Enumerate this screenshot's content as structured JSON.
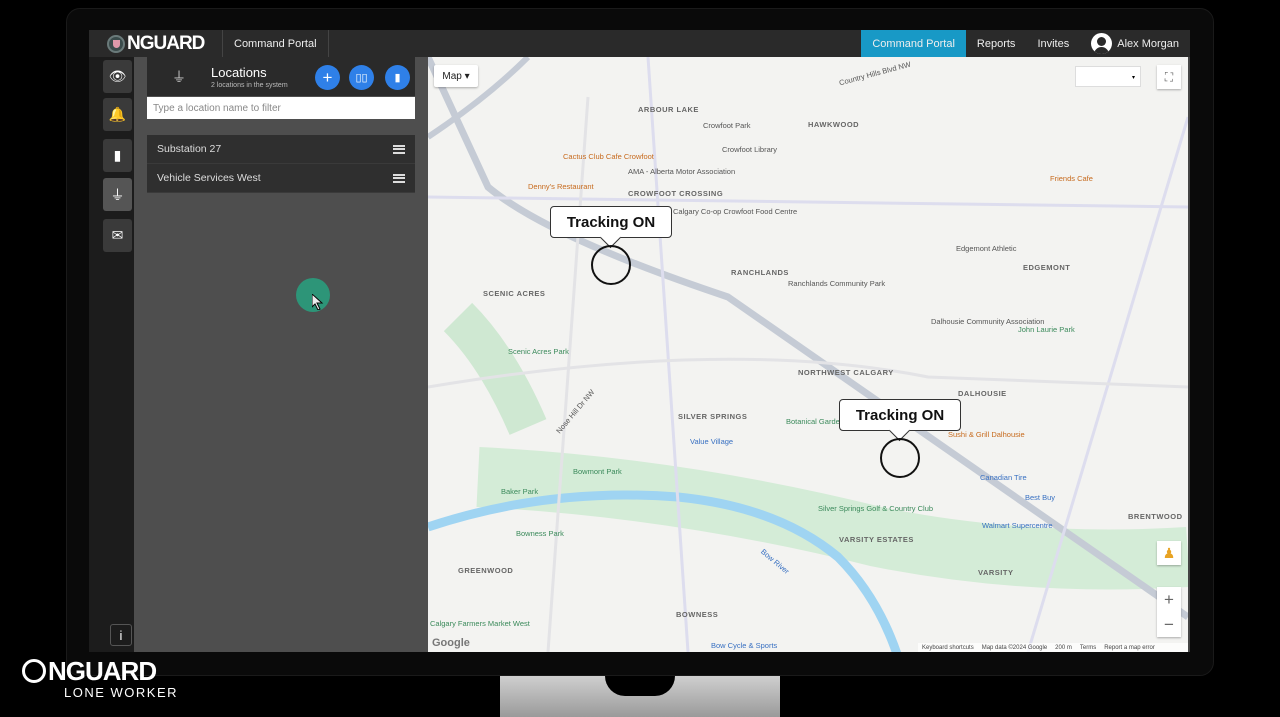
{
  "header": {
    "brand": "NGUARD",
    "title": "Command Portal",
    "nav": [
      {
        "label": "Command Portal",
        "active": true
      },
      {
        "label": "Reports"
      },
      {
        "label": "Invites"
      }
    ],
    "user": "Alex Morgan",
    "accent": "#1899c6"
  },
  "rail": {
    "items": [
      "eye-icon",
      "bell-icon",
      "worker-device-icon",
      "location-pin-icon",
      "envelope-icon"
    ],
    "info": "i"
  },
  "panel": {
    "title": "Locations",
    "subtitle": "2 locations in the system",
    "filter_placeholder": "Type a location name to filter",
    "items": [
      "Substation 27",
      "Vehicle Services West"
    ],
    "button_color": "#2f80e8"
  },
  "map": {
    "type_label": "Map",
    "trackers": [
      "Tracking ON",
      "Tracking ON"
    ],
    "labels": [
      "ARBOUR LAKE",
      "HAWKWOOD",
      "Crowfoot Park",
      "Crowfoot Library",
      "Cactus Club Cafe Crowfoot",
      "AMA - Alberta Motor Association",
      "Denny's Restaurant",
      "CROWFOOT CROSSING",
      "Calgary Co-op Crowfoot Food Centre",
      "RANCHLANDS",
      "Ranchlands Community Park",
      "SCENIC ACRES",
      "Scenic Acres Park",
      "Edgemont Athletic",
      "EDGEMONT",
      "Friends Cafe",
      "Dalhousie Community Association",
      "John Laurie Park",
      "NORTHWEST CALGARY",
      "DALHOUSIE",
      "SILVER SPRINGS",
      "Botanical Gardens of Silver Springs",
      "Value Village",
      "Sushi & Grill Dalhousie",
      "Canadian Tire",
      "Best Buy",
      "Walmart Supercentre",
      "Bowmont Park",
      "Baker Park",
      "Silver Springs Golf & Country Club",
      "BRENTWOOD",
      "Bowness Park",
      "VARSITY ESTATES",
      "VARSITY",
      "GREENWOOD",
      "BOWNESS",
      "Calgary Farmers Market West",
      "Bow Cycle & Sports",
      "Country Hills Blvd NW",
      "Nose Hill Dr NW",
      "Bow River"
    ],
    "footer": {
      "shortcuts": "Keyboard shortcuts",
      "data": "Map data ©2024 Google",
      "scale": "200 m",
      "terms": "Terms",
      "report": "Report a map error"
    },
    "google": "Google",
    "zoom_in": "+",
    "zoom_out": "−"
  },
  "branding": {
    "name": "NGUARD",
    "tagline": "LONE WORKER"
  }
}
